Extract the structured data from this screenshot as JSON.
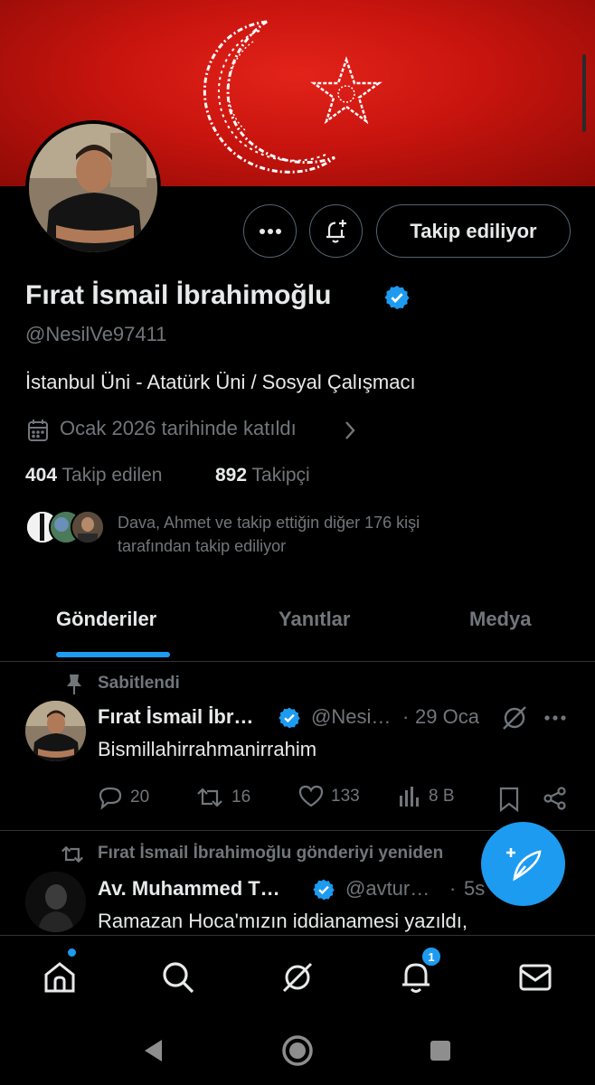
{
  "profile": {
    "name": "Fırat İsmail İbrahimoğlu",
    "handle": "@NesilVe97411",
    "bio": "İstanbul Üni - Atatürk Üni / Sosyal Çalışmacı",
    "joined": "Ocak 2026 tarihinde katıldı",
    "following_count": "404",
    "following_label": "Takip edilen",
    "followers_count": "892",
    "followers_label": "Takipçi",
    "followed_by_line1": "Dava, Ahmet ve takip ettiğin diğer 176 kişi",
    "followed_by_line2": "tarafından takip ediliyor"
  },
  "actions": {
    "follow_label": "Takip ediliyor",
    "more_icon": "more-horizontal-icon",
    "notify_icon": "bell-plus-icon"
  },
  "tabs": [
    {
      "label": "Gönderiler",
      "active": true
    },
    {
      "label": "Yanıtlar",
      "active": false
    },
    {
      "label": "Medya",
      "active": false
    }
  ],
  "posts": [
    {
      "context": "Sabitlendi",
      "name": "Fırat İsmail İbr…",
      "handle": "@Nesi…",
      "separator": "·",
      "date": "29 Oca",
      "text": "Bismillahirrahmanirrahim",
      "replies": "20",
      "reposts": "16",
      "likes": "133",
      "views": "8 B"
    },
    {
      "context": "Fırat İsmail İbrahimoğlu gönderiyi yeniden",
      "name": "Av. Muhammed T…",
      "handle": "@avtur…",
      "separator": "·",
      "time": "5s",
      "text": "Ramazan Hoca'mızın iddianamesi yazıldı,"
    }
  ],
  "bottom_nav": {
    "items": [
      "home-icon",
      "search-icon",
      "grok-icon",
      "notifications-icon",
      "messages-icon"
    ],
    "notification_badge": "1"
  },
  "colors": {
    "accent": "#1d9bf0",
    "background": "#000000",
    "muted": "#71767b",
    "banner_red": "#d11a12"
  }
}
